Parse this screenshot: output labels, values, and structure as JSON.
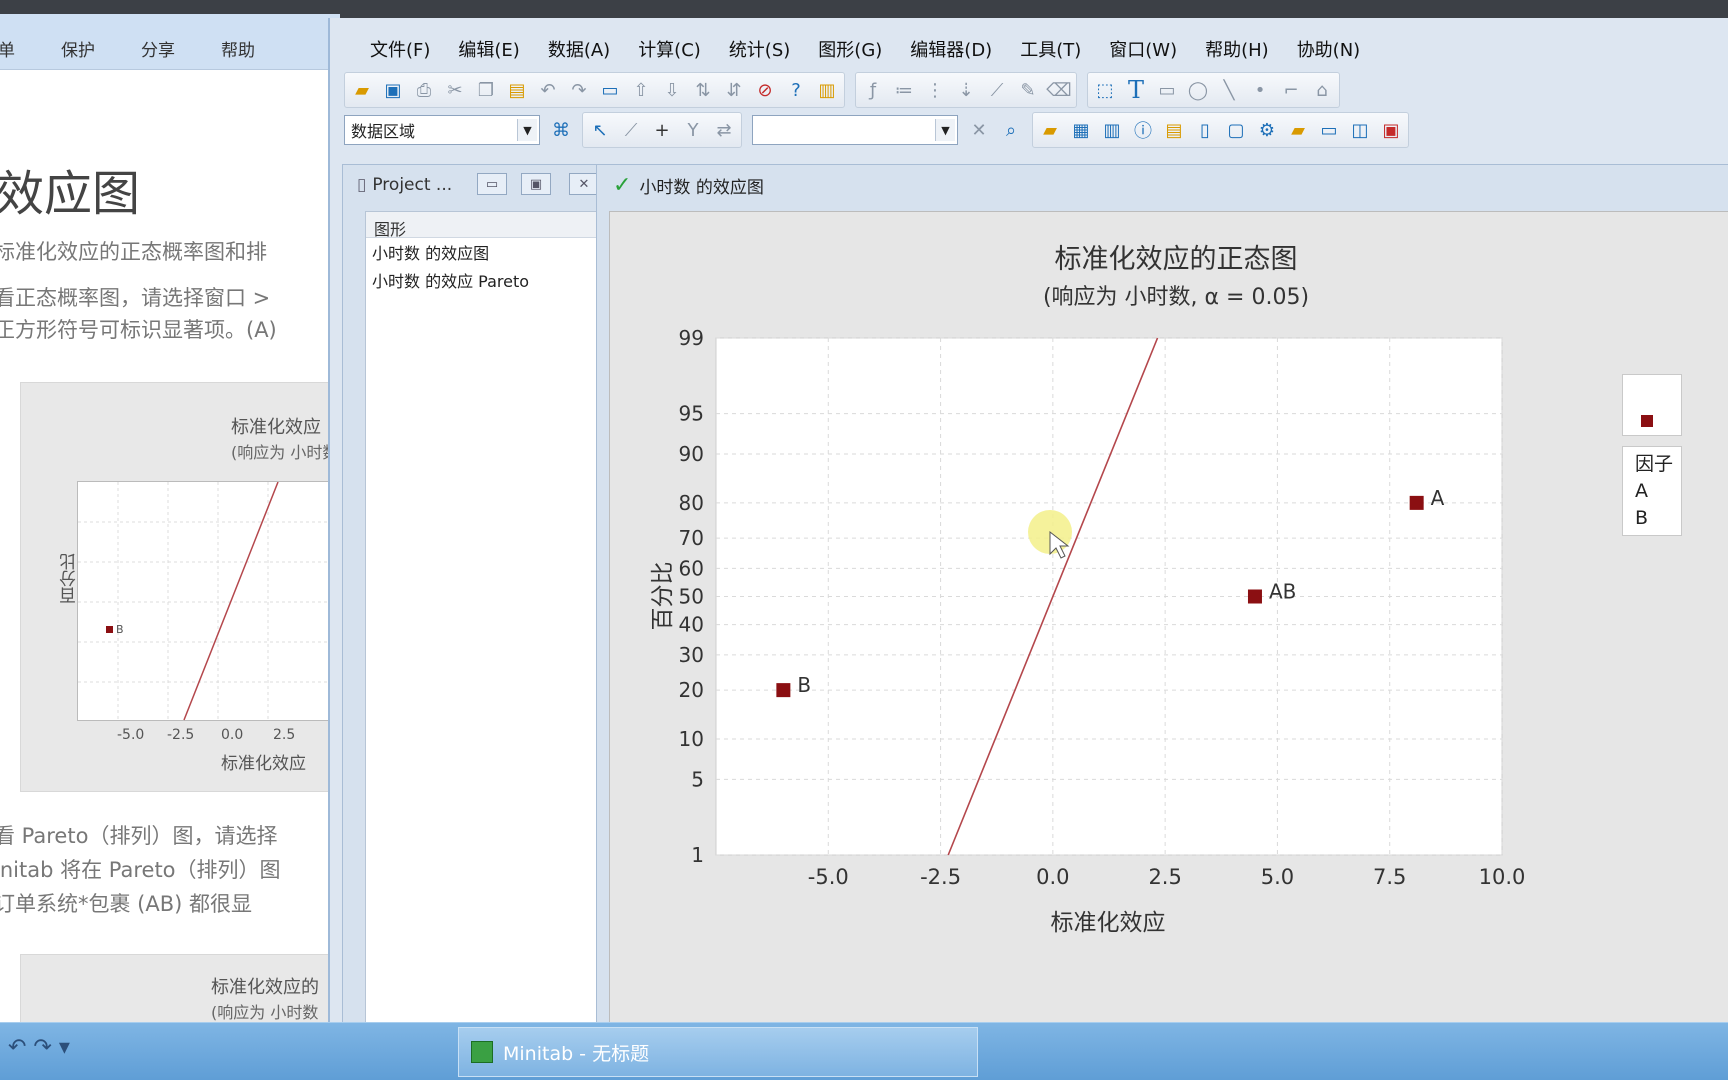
{
  "help": {
    "menu": [
      "单",
      "保护",
      "分享",
      "帮助"
    ],
    "title": "效应图",
    "lines": [
      "标准化效应的正态概率图和排",
      "看正态概率图，请选择窗口 >",
      "正方形符号可标识显著项。(A)",
      "看 Pareto（排列）图，请选择",
      "initab 将在 Pareto（排列）图",
      "订单系统*包裹 (AB) 都很显"
    ],
    "mini_chart": {
      "title": "标准化效应",
      "subtitle": "(响应为 小时数",
      "ylabel": "百分比",
      "xlabel": "标准化效应",
      "ticks": [
        "-5.0",
        "-2.5",
        "0.0",
        "2.5"
      ],
      "point_label": "B"
    },
    "mini_chart2": {
      "title": "标准化效应的",
      "subtitle": "(响应为 小时数"
    }
  },
  "menubar": [
    "文件(F)",
    "编辑(E)",
    "数据(A)",
    "计算(C)",
    "统计(S)",
    "图形(G)",
    "编辑器(D)",
    "工具(T)",
    "窗口(W)",
    "帮助(H)",
    "协助(N)"
  ],
  "toolbar": {
    "combo_value": "数据区域",
    "combo2_value": ""
  },
  "project": {
    "title": "Project ...",
    "header": "图形",
    "items": [
      "小时数 的效应图",
      "小时数 的效应 Pareto"
    ]
  },
  "graph_window": {
    "title": "小时数 的效应图"
  },
  "chart_data": {
    "type": "scatter",
    "title": "标准化效应的正态图",
    "subtitle": "(响应为 小时数, α = 0.05)",
    "xlabel": "标准化效应",
    "ylabel": "百分比",
    "xlim": [
      -7.5,
      10.0
    ],
    "x_ticks": [
      -5.0,
      -2.5,
      0.0,
      2.5,
      5.0,
      7.5,
      10.0
    ],
    "x_tick_labels": [
      "-5.0",
      "-2.5",
      "0.0",
      "2.5",
      "5.0",
      "7.5",
      "10.0"
    ],
    "y_scale": "normal-probability",
    "y_ticks": [
      1,
      5,
      10,
      20,
      30,
      40,
      50,
      60,
      70,
      80,
      90,
      95,
      99
    ],
    "y_tick_labels": [
      "1",
      "5",
      "10",
      "20",
      "30",
      "40",
      "50",
      "60",
      "70",
      "80",
      "90",
      "95",
      "99"
    ],
    "grid": true,
    "points": [
      {
        "label": "B",
        "x": -6.0,
        "y": 20
      },
      {
        "label": "AB",
        "x": 4.5,
        "y": 50
      },
      {
        "label": "A",
        "x": 8.1,
        "y": 80
      }
    ],
    "reference_line": {
      "x_at_y1": -2.33,
      "x_at_y99": 2.33,
      "color": "#b4474c"
    },
    "point_color": "#8b0f12",
    "legend": {
      "header": "因子",
      "entries": [
        "A",
        "B"
      ]
    }
  },
  "taskbar": {
    "app_title": "Minitab - 无标题",
    "quick": "↶ ↷ ▾"
  }
}
